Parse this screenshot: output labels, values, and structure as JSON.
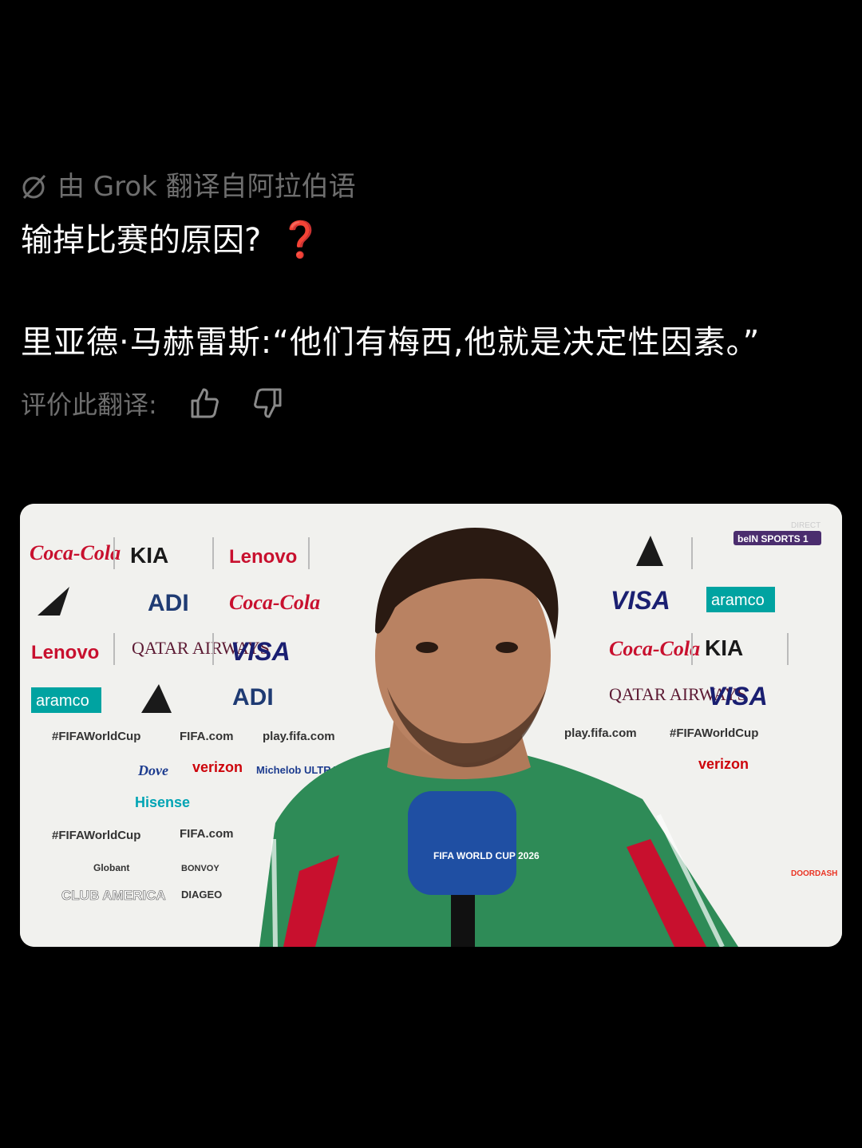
{
  "translation": {
    "meta_text": "由 Grok 翻译自阿拉伯语",
    "icon": "grok-icon"
  },
  "post": {
    "line1": "输掉比赛的原因?",
    "line1_emoji": "❓",
    "quote": "里亚德·马赫雷斯:“他们有梅西,他就是决定性因素。”"
  },
  "rating": {
    "label": "评价此翻译:",
    "like_icon": "thumbs-up-icon",
    "dislike_icon": "thumbs-down-icon"
  },
  "video": {
    "sponsors": [
      "Coca-Cola",
      "KIA",
      "Lenovo",
      "QATAR AIRWAYS",
      "aramco",
      "ADI",
      "VISA",
      "Hisense",
      "verizon",
      "Dove",
      "Michelob ULTRA",
      "Globant",
      "BONVOY",
      "DIAGEO",
      "DOORDASH"
    ],
    "hashtag": "#FIFAWorldCup",
    "site1": "FIFA.com",
    "site2": "play.fifa.com",
    "broadcaster": "beIN SPORTS 1",
    "live_label": "DIRECT",
    "watermark": "CLUB AMERICA",
    "mic_text": "FIFA WORLD CUP 2026"
  },
  "colors": {
    "accent_red": "#e0242b",
    "muted": "#6e6e6e",
    "jersey_green": "#2e8b57"
  }
}
